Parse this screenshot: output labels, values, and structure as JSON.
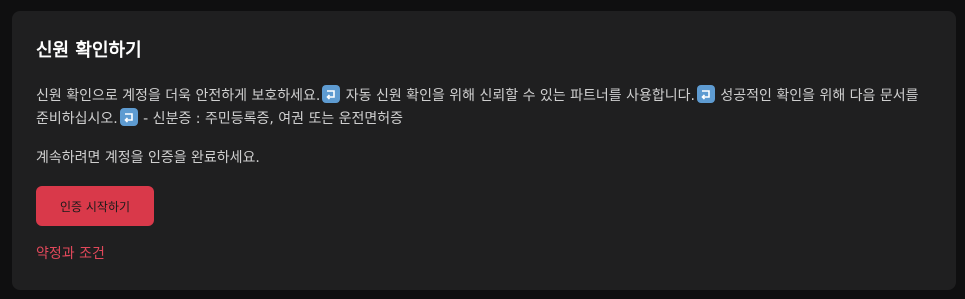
{
  "card": {
    "title": "신원 확인하기",
    "description": {
      "part1": "신원 확인으로 계정을 더욱 안전하게 보호하세요.",
      "part2": " 자동 신원 확인을 위해 신뢰할 수 있는 파트너를 사용합니다.",
      "part3": " 성공적인 확인을 위해 다음 문서를 준비하십시오.",
      "part4": " - 신분증 : 주민등록증, 여권 또는 운전면허증"
    },
    "return_icon_name": "return-arrow-icon",
    "continue_text": "계속하려면 계정을 인증을 완료하세요.",
    "start_button_label": "인증 시작하기",
    "terms_link_label": "약정과 조건"
  },
  "colors": {
    "background": "#0f0f10",
    "card": "#1f1f20",
    "accent": "#d9394a",
    "link": "#e0485a",
    "emoji": "#5e9bd1"
  }
}
